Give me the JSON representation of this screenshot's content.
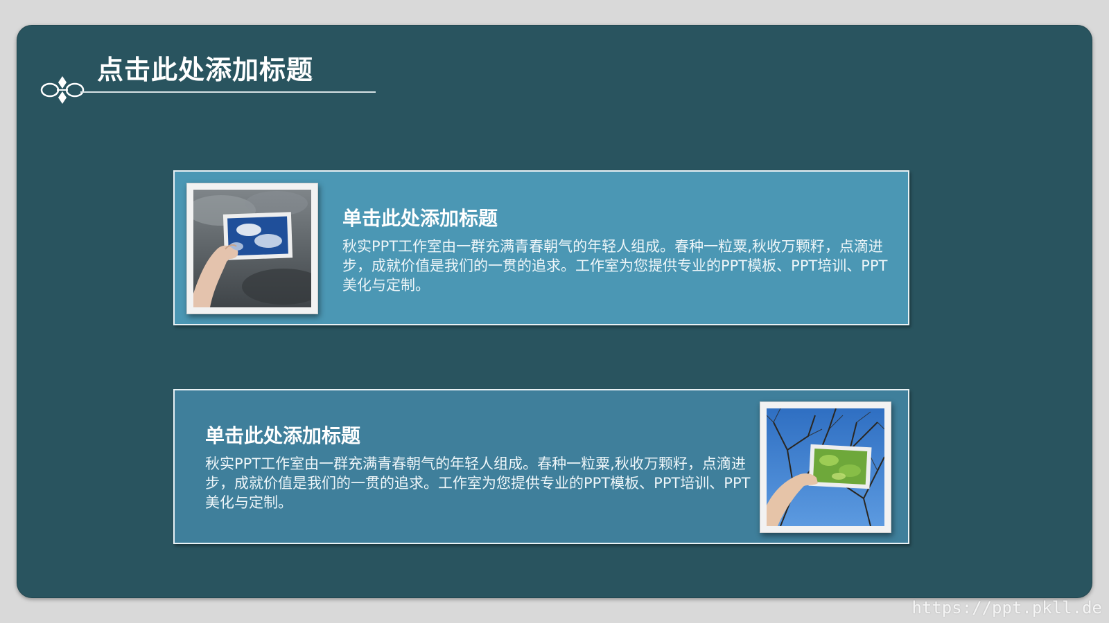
{
  "slide": {
    "title": "点击此处添加标题",
    "colors": {
      "background": "#29545f",
      "card_1": "#4b97b4",
      "card_2": "#3f7f9b",
      "text": "#ffffff"
    },
    "cards": [
      {
        "title": "单击此处添加标题",
        "body": "秋实PPT工作室由一群充满青春朝气的年轻人组成。春种一粒粟,秋收万颗籽，点滴进步，成就价值是我们的一贯的追求。工作室为您提供专业的PPT模板、PPT培训、PPT美化与定制。",
        "image": "hand-holding-sky-photo"
      },
      {
        "title": "单击此处添加标题",
        "body": "秋实PPT工作室由一群充满青春朝气的年轻人组成。春种一粒粟,秋收万颗籽，点滴进步，成就价值是我们的一贯的追求。工作室为您提供专业的PPT模板、PPT培训、PPT美化与定制。",
        "image": "hand-holding-leaves-photo"
      }
    ]
  },
  "watermark": "https://ppt.pkll.de"
}
